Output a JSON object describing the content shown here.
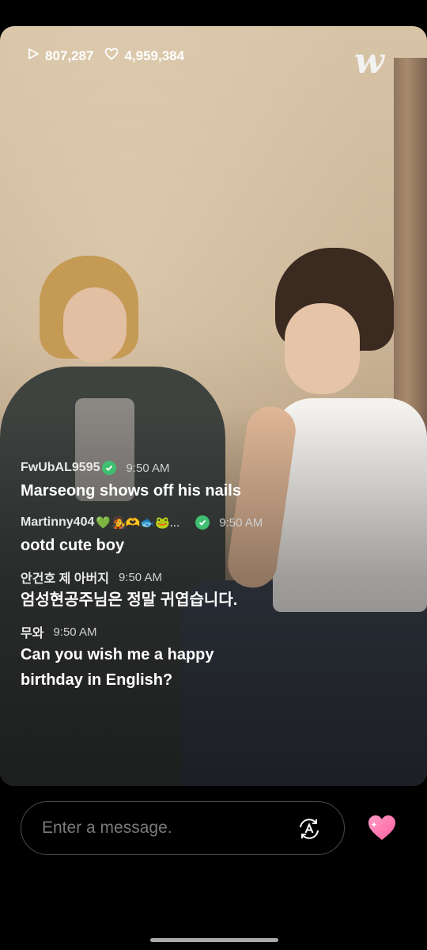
{
  "stats": {
    "views": "807,287",
    "likes": "4,959,384"
  },
  "logo": "w",
  "comments": [
    {
      "user": "FwUbAL9595",
      "verified": true,
      "emoji": "",
      "time": "9:50 AM",
      "text": "Marseong shows off his nails"
    },
    {
      "user": "Martinny404",
      "verified": true,
      "emoji": "💚🧑‍🎤🫶🐟🐸...",
      "time": "9:50 AM",
      "text": "ootd cute boy"
    },
    {
      "user": "안건호 제 아버지",
      "verified": false,
      "emoji": "",
      "time": "9:50 AM",
      "text": "엄성현공주님은 정말 귀엽습니다."
    },
    {
      "user": "무와",
      "verified": false,
      "emoji": "",
      "time": "9:50 AM",
      "text": "Can you wish me a happy birthday in English?"
    }
  ],
  "input": {
    "placeholder": "Enter a message."
  },
  "colors": {
    "verified": "#3fbf6f",
    "heart": "#ff7fb0",
    "background": "#000000"
  },
  "icons": {
    "views": "play-icon",
    "likes": "heart-outline-icon",
    "translate": "translate-icon",
    "react": "heart-icon"
  }
}
